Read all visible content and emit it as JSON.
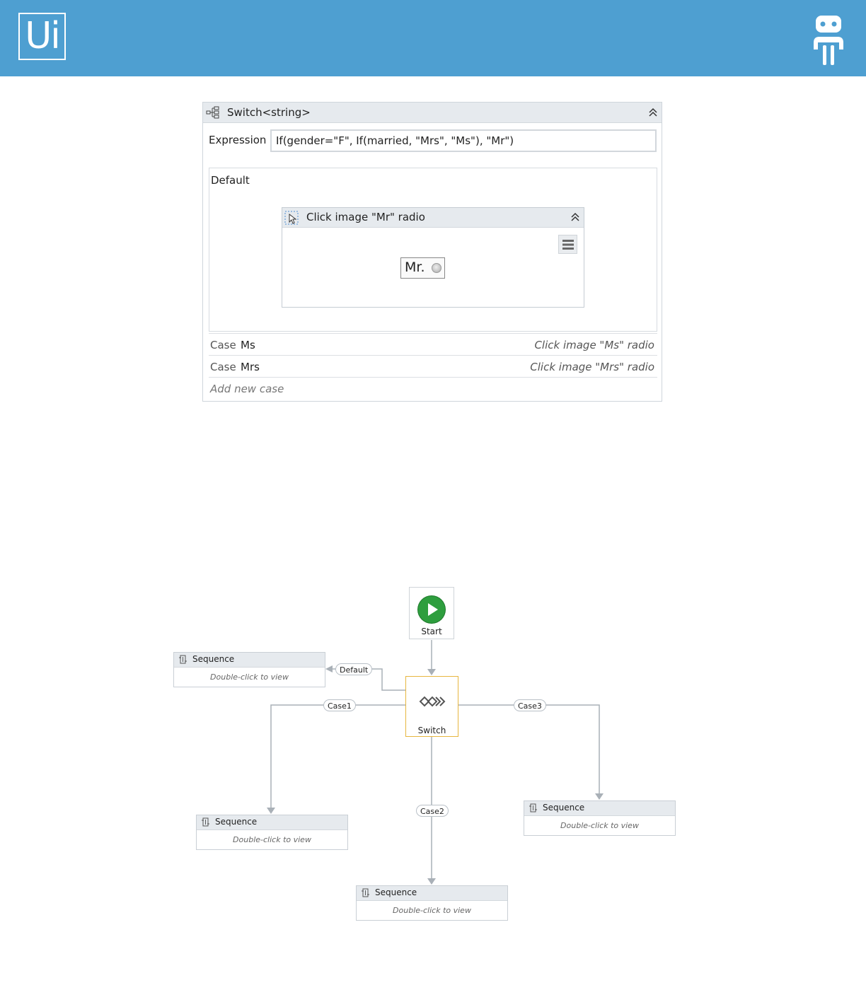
{
  "header": {
    "logo_text": "Ui",
    "bg_color": "#4e9fd1",
    "right_icon": "robot-icon"
  },
  "switch_activity": {
    "title": "Switch<string>",
    "expression_label": "Expression",
    "expression_value": "If(gender=\"F\", If(married, \"Mrs\", \"Ms\"), \"Mr\")",
    "default_label": "Default",
    "default_activity": {
      "title": "Click image \"Mr\" radio",
      "image_text": "Mr."
    },
    "cases": [
      {
        "keyword": "Case",
        "value": "Ms",
        "activity": "Click image \"Ms\" radio"
      },
      {
        "keyword": "Case",
        "value": "Mrs",
        "activity": "Click image \"Mrs\" radio"
      }
    ],
    "add_case": "Add new case"
  },
  "flowchart": {
    "start_label": "Start",
    "switch_label": "Switch",
    "connectors": {
      "default": "Default",
      "case1": "Case1",
      "case2": "Case2",
      "case3": "Case3"
    },
    "sequences": [
      {
        "title": "Sequence",
        "hint": "Double-click to view"
      },
      {
        "title": "Sequence",
        "hint": "Double-click to view"
      },
      {
        "title": "Sequence",
        "hint": "Double-click to view"
      },
      {
        "title": "Sequence",
        "hint": "Double-click to view"
      }
    ],
    "colors": {
      "start": "#2e9e3e",
      "switch_border": "#e7b63f",
      "connector": "#a9b0b7"
    }
  }
}
